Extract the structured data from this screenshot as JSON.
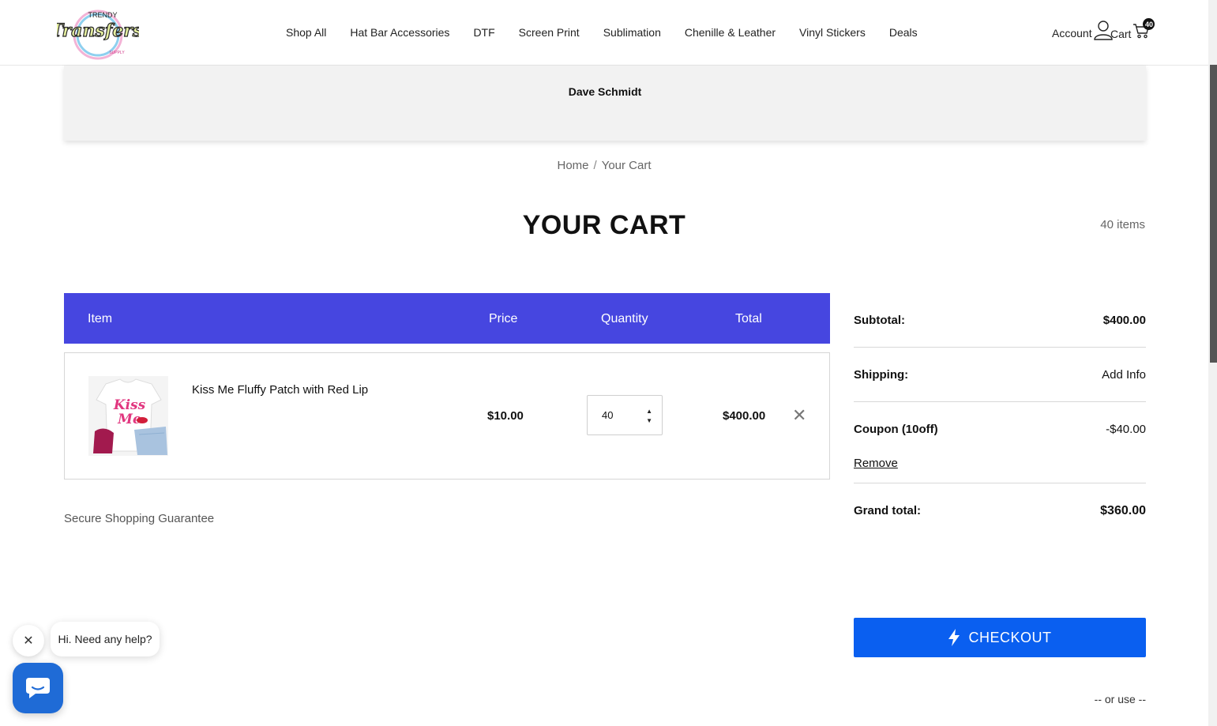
{
  "brand": {
    "logo_alt": "Trendy Transfers"
  },
  "nav": {
    "items": [
      "Shop All",
      "Hat Bar Accessories",
      "DTF",
      "Screen Print",
      "Sublimation",
      "Chenille & Leather",
      "Vinyl Stickers",
      "Deals"
    ]
  },
  "header": {
    "account_label": "Account",
    "cart_label": "Cart",
    "cart_count": "40"
  },
  "banner": {
    "customer_name": "Dave Schmidt"
  },
  "breadcrumb": {
    "home": "Home",
    "separator": "/",
    "current": "Your Cart"
  },
  "page": {
    "title": "YOUR CART",
    "item_count": "40 items"
  },
  "table": {
    "headers": {
      "item": "Item",
      "price": "Price",
      "quantity": "Quantity",
      "total": "Total"
    },
    "rows": [
      {
        "name": "Kiss Me Fluffy Patch with Red Lip",
        "price": "$10.00",
        "quantity": "40",
        "total": "$400.00"
      }
    ]
  },
  "secure_text": "Secure Shopping Guarantee",
  "summary": {
    "subtotal_label": "Subtotal:",
    "subtotal_value": "$400.00",
    "shipping_label": "Shipping:",
    "shipping_value": "Add Info",
    "coupon_label": "Coupon (10off)",
    "coupon_value": "-$40.00",
    "coupon_remove": "Remove",
    "grand_label": "Grand total:",
    "grand_value": "$360.00"
  },
  "checkout": {
    "label": "CHECKOUT",
    "or_use": "-- or use --"
  },
  "chat": {
    "message": "Hi. Need any help?"
  },
  "colors": {
    "table_header": "#4646e0",
    "checkout": "#0a5ff0",
    "chat_button": "#1f6bd6"
  }
}
